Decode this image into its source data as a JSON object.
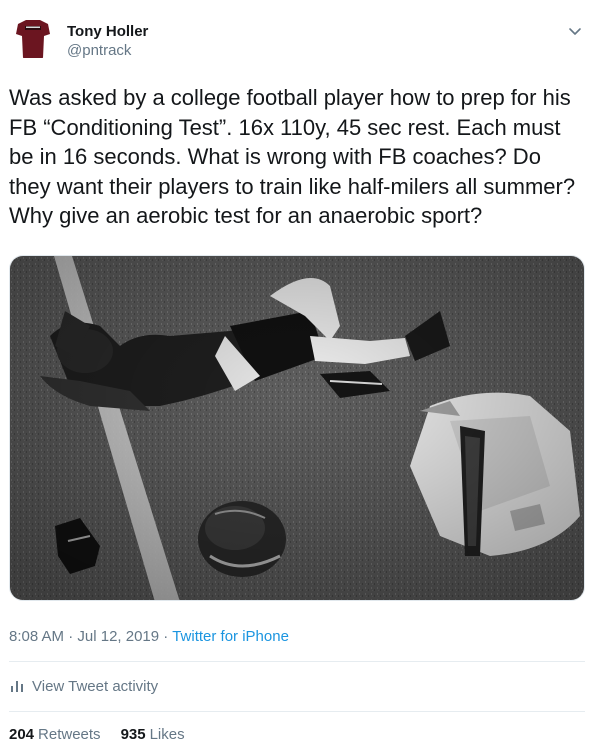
{
  "author": {
    "name": "Tony Holler",
    "handle": "@pntrack"
  },
  "tweet": {
    "text": "Was asked by a college football player how to prep for his FB “Conditioning Test”. 16x 110y, 45 sec rest. Each must be in 16 seconds. What is wrong with FB coaches? Do they want their players to train like half-milers all summer? Why give an aerobic test for an anaerobic sport?"
  },
  "meta": {
    "time": "8:08 AM",
    "separator1": " · ",
    "date": "Jul 12, 2019",
    "separator2": " · ",
    "source": "Twitter for iPhone"
  },
  "activity": {
    "label": "View Tweet activity"
  },
  "stats": {
    "retweets_count": "204",
    "retweets_label": "Retweets",
    "likes_count": "935",
    "likes_label": "Likes"
  },
  "colors": {
    "link": "#1b95e0",
    "secondary_text": "#657786",
    "primary_text": "#14171a",
    "divider": "#e6ecf0"
  }
}
